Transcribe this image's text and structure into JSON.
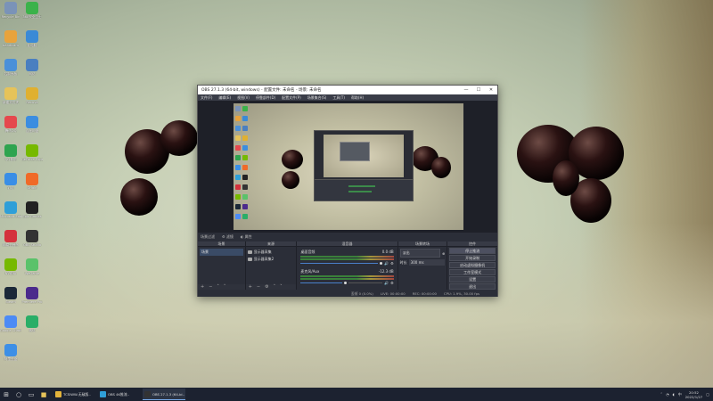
{
  "desktop": {
    "icons": [
      {
        "label": "Recycle Bin",
        "color": "#7a93b8"
      },
      {
        "label": "360安全卫士",
        "color": "#3bb24a"
      },
      {
        "label": "bandicam",
        "color": "#e8a33c"
      },
      {
        "label": "此电脑",
        "color": "#3a8ad6"
      },
      {
        "label": "控制面板",
        "color": "#4a90d9"
      },
      {
        "label": "网络",
        "color": "#4a7fc0"
      },
      {
        "label": "新建文件夹",
        "color": "#e6c35a"
      },
      {
        "label": "Recuva",
        "color": "#e0b030"
      },
      {
        "label": "腾讯QQ",
        "color": "#e5484d"
      },
      {
        "label": "百度网盘",
        "color": "#3b8de0"
      },
      {
        "label": "QQ音乐",
        "color": "#2ea44f"
      },
      {
        "label": "GeForce Experience",
        "color": "#76b900"
      },
      {
        "label": "钉钉",
        "color": "#3a8ee6"
      },
      {
        "label": "Origin",
        "color": "#f06a28"
      },
      {
        "label": "Microsoft Edge",
        "color": "#2f9fd8"
      },
      {
        "label": "Epic Games",
        "color": "#222"
      },
      {
        "label": "网易云音乐",
        "color": "#d4323c"
      },
      {
        "label": "OBS Studio",
        "color": "#333"
      },
      {
        "label": "NVIDIA",
        "color": "#76b900"
      },
      {
        "label": "WeGame",
        "color": "#5ac26a"
      },
      {
        "label": "Steam",
        "color": "#1b2838"
      },
      {
        "label": "Premiere Pro",
        "color": "#4b2a8c"
      },
      {
        "label": "Google Chrome",
        "color": "#4c8bf5"
      },
      {
        "label": "微信",
        "color": "#2aae67"
      },
      {
        "label": "阿里云盘",
        "color": "#3d8fe6"
      }
    ]
  },
  "obs": {
    "title": "OBS 27.1.3 (64-bit, windows) - 配置文件: 未命名 - 场景: 未命名",
    "menu": [
      "文件(F)",
      "编辑(E)",
      "视图(V)",
      "停靠部件(D)",
      "配置文件(P)",
      "场景集合(S)",
      "工具(T)",
      "帮助(H)"
    ],
    "toolbar": {
      "scene_filter": "场景过滤",
      "filters": "滤镜",
      "properties": "属性"
    },
    "docks": {
      "scenes": {
        "title": "场景",
        "items": [
          "场景"
        ]
      },
      "sources": {
        "title": "来源",
        "items": [
          "显示器采集",
          "显示器采集2"
        ]
      },
      "mixer": {
        "title": "混音器",
        "channels": [
          {
            "name": "桌面音频",
            "level": "0.0 dB"
          },
          {
            "name": "麦克风/Aux",
            "level": "-12.3 dB"
          }
        ]
      },
      "transitions": {
        "title": "场景转场",
        "type": "淡出",
        "duration_label": "时长",
        "duration": "300 ms"
      },
      "controls": {
        "title": "控件",
        "buttons": [
          "停止推流",
          "开始录制",
          "启动虚拟摄像机",
          "工作室模式",
          "设置",
          "退出"
        ]
      }
    },
    "status": {
      "dropped": "丢帧 0 (0.0%)",
      "live": "LIVE: 00:00:00",
      "rec": "REC: 00:00:00",
      "cpu": "CPU: 1.9%, 30.00 fps"
    }
  },
  "taskbar": {
    "tasks": [
      {
        "label": "TCSiWW-无敌版..",
        "color": "#e2b33b",
        "active": false
      },
      {
        "label": "OBS 4K推流..",
        "color": "#2f9fd8",
        "active": false
      },
      {
        "label": "OBS 27.1.3 (64-bi..",
        "color": "#333",
        "active": true
      }
    ],
    "time": "20:52",
    "date": "2022/1/27"
  }
}
